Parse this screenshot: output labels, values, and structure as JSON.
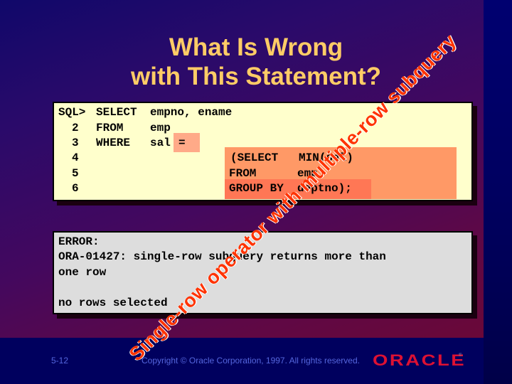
{
  "slide": {
    "title_line1": "What Is Wrong",
    "title_line2": "with This Statement?",
    "code_lines": [
      {
        "num": "SQL>",
        "keyword": "SELECT",
        "rest": "empno, ename"
      },
      {
        "num": "2",
        "keyword": "FROM",
        "rest": "emp"
      },
      {
        "num": "3",
        "keyword": "WHERE",
        "rest": "sal"
      },
      {
        "num": "4",
        "keyword": "",
        "rest": ""
      },
      {
        "num": "5",
        "keyword": "",
        "rest": ""
      },
      {
        "num": "6",
        "keyword": "",
        "rest": ""
      }
    ],
    "operator": "=",
    "subquery_lines": [
      "(SELECT   MIN(sal)",
      "FROM      emp",
      "GROUP BY  deptno);"
    ],
    "error_lines": [
      "ERROR:",
      "ORA-01427: single-row subquery returns more than",
      "one row",
      "",
      "no rows selected"
    ],
    "annotation": "Single-row operator with multiple-row subquery"
  },
  "footer": {
    "page_number": "5-12",
    "copyright": "Copyright © Oracle Corporation, 1997. All rights reserved.",
    "logo": "ORACLE",
    "logo_mark": "®"
  },
  "colors": {
    "title": "#ffcc66",
    "code_bg": "#ffffcc",
    "subquery_bg": "#ff9966",
    "error_bg": "#dddddd",
    "annotation": "#ff3300",
    "logo": "#dd1133"
  }
}
